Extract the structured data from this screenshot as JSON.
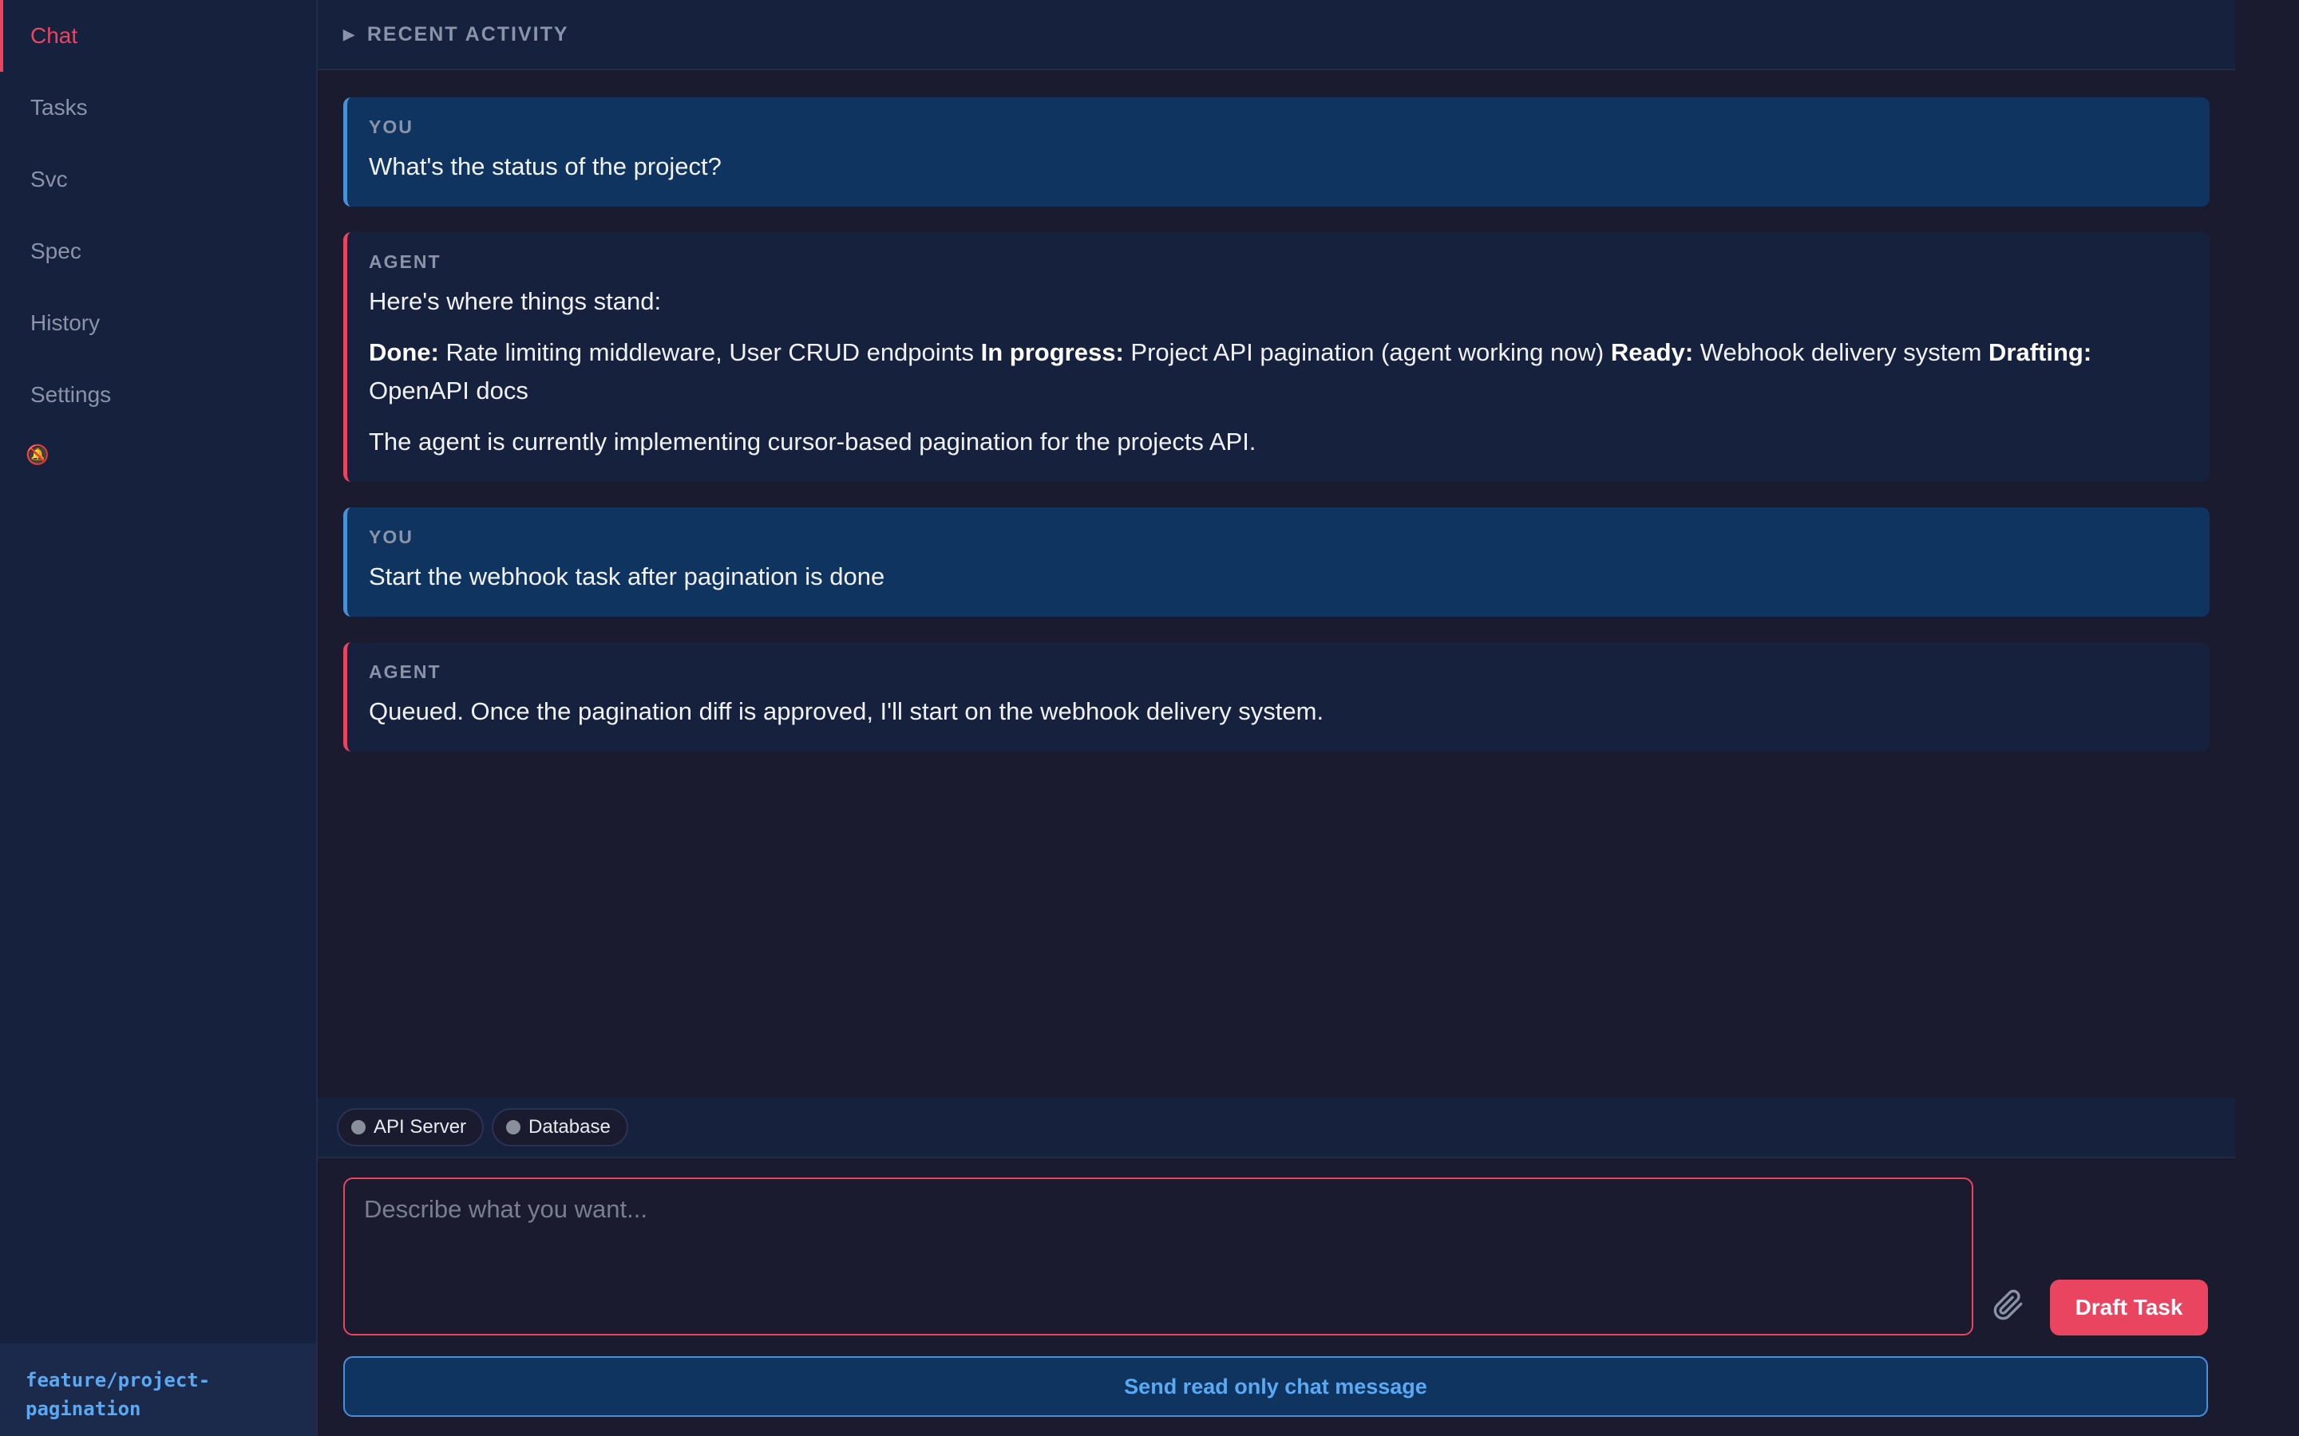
{
  "sidebar": {
    "items": [
      {
        "label": "Chat"
      },
      {
        "label": "Tasks"
      },
      {
        "label": "Svc"
      },
      {
        "label": "Spec"
      },
      {
        "label": "History"
      },
      {
        "label": "Settings"
      }
    ],
    "bell_icon": "🔕",
    "branch": "feature/project-pagination"
  },
  "activity": {
    "label": "RECENT ACTIVITY"
  },
  "messages": [
    {
      "role": "YOU",
      "text": "What's the status of the project?"
    },
    {
      "role": "AGENT",
      "intro": "Here's where things stand:",
      "done_label": "Done:",
      "done_text": " Rate limiting middleware, User CRUD endpoints ",
      "progress_label": "In progress:",
      "progress_text": " Project API pagination (agent working now) ",
      "ready_label": "Ready:",
      "ready_text": " Webhook delivery system ",
      "drafting_label": "Drafting:",
      "drafting_text": " OpenAPI docs",
      "outro": "The agent is currently implementing cursor-based pagination for the projects API."
    },
    {
      "role": "YOU",
      "text": "Start the webhook task after pagination is done"
    },
    {
      "role": "AGENT",
      "text": "Queued. Once the pagination diff is approved, I'll start on the webhook delivery system."
    }
  ],
  "services": [
    {
      "label": "API Server"
    },
    {
      "label": "Database"
    }
  ],
  "composer": {
    "placeholder": "Describe what you want...",
    "draft_label": "Draft Task",
    "readonly_label": "Send read only chat message"
  },
  "colors": {
    "accent": "#e94560",
    "user_border": "#4a90d9",
    "service_dot": "#8a8f9c"
  }
}
